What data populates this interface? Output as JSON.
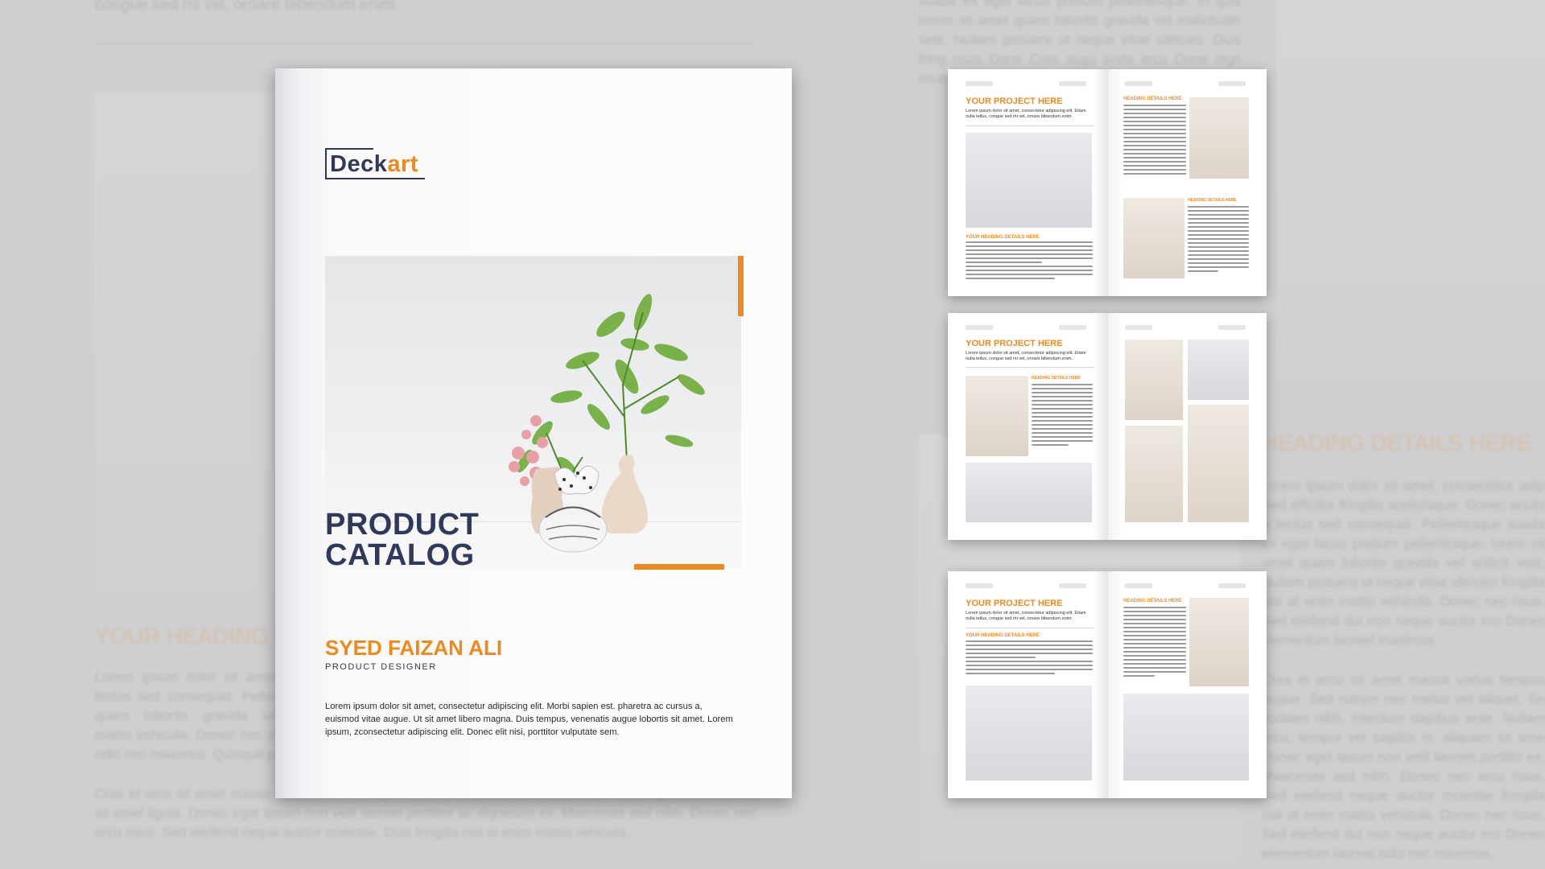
{
  "background": {
    "top_text": "congue sed mi vel, ornare bibendum enim.",
    "heading_left": "YOUR HEADING D",
    "para_left_1": "Lorem ipsum dolor sit amet, lectus sed consequat. Pellen quam lobortis gravida vel mattis vehicula. Donec nec ar odio nec maximus. Quisque p",
    "para_left_2": "Cras et arcu sit amet massa nibh, interdum dapibus ante. Nullam nulla arcu, tempor vel sagittis in, aliquam sit amet ligula. Donec eget ipsum non velit laoreet porttitor ac dignissim ex. Maecenas sed nibh. Donec nec arcu risus. Sed eleifend neque auctor molestie. Duis fringilla nisl at enim mattis vehicula.",
    "para_mid": "suada ex eget lacus pretium pellentesque. In quis lorem sit amet quam lobortis gravida vel sollicitudin velit. Nullam posuere ut neque vitae ultricies. Duis fring risus Done Cras augu soda arcu Done dign risus fring Done",
    "heading_right": "HEADING DETAILS HERE",
    "para_right_1": "Lorem ipsum dolor sit amet, consectetur adip Sed efficitur fringilla scelerisque. Donec aculis a lectus sed consequat. Pellentesque suada ex eget lacus pretium pellentesque. lorem sit amet quam lobortis gravida vel sollicit velit. Nullam posuere ut neque vitae ultricies fringilla nisl at enim mattis vehicula. Donec nec risus. Sed eleifend dui non neque auctor mo Donec elementum laoreet maximus.",
    "para_right_2": "Cras et arcu sit amet massa varius tempus augue. Sed rutrum nec metus vel aliquet. Se sodales nibh, interdum dapibus ante. Nullam arcu, tempor vel sagittis in, aliquam sit ame Donec eget ipsum non velit laoreet porttito ex. Maecenas sed nibh. Donec nec arcu risus. Sed eleifend neque auctor molestie fringilla nisl at enim mattis vehicula. Donec nec risus. Sed eleifend dui non neque auctor mo Donec elementum laoreet odio nec maximus."
  },
  "cover": {
    "logo_part1": "Deck",
    "logo_part2": "art",
    "title_line1": "PRODUCT",
    "title_line2": "CATALOG",
    "name": "SYED FAIZAN ALI",
    "role": "PRODUCT DESIGNER",
    "description": "Lorem ipsum dolor sit amet, consectetur adipiscing elit. Morbi sapien est. pharetra ac cursus a, euismod vitae augue. Ut sit amet libero magna. Duis tempus, venenatis augue lobortis sit amet. Lorem ipsum, zconsectetur adipiscing elit. Donec elit nisi, porttitor vulputate sem."
  },
  "spreads": {
    "title": "YOUR PROJECT HERE",
    "subheading": "HEADING DETAILS HERE",
    "subheading_small": "YOUR HEADING DETAILS HERE",
    "intro": "Lorem ipsum dolor sit amet, consectetur adipiscing elit. Etiam nulla tellus, congue sed mi vel, ornare bibendum enim."
  },
  "colors": {
    "accent": "#ee8a1d",
    "navy": "#2f3a5a"
  }
}
